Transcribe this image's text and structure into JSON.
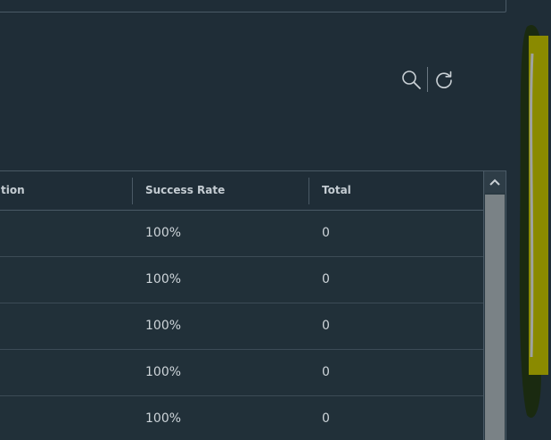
{
  "toolbar": {
    "search_icon": "search-icon",
    "refresh_icon": "refresh-icon"
  },
  "grid": {
    "columns": [
      {
        "label": "tion"
      },
      {
        "label": "Success Rate"
      },
      {
        "label": "Total"
      }
    ],
    "rows": [
      {
        "success_rate": "100%",
        "total": "0"
      },
      {
        "success_rate": "100%",
        "total": "0"
      },
      {
        "success_rate": "100%",
        "total": "0"
      },
      {
        "success_rate": "100%",
        "total": "0"
      },
      {
        "success_rate": "100%",
        "total": "0"
      }
    ]
  },
  "colors": {
    "background": "#1f2d37",
    "border": "#4a5a66",
    "scroll_highlight": "#8a8a00"
  }
}
